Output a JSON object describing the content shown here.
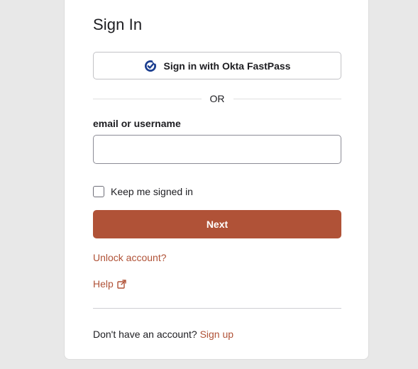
{
  "form": {
    "title": "Sign In",
    "fastpass_label": "Sign in with Okta FastPass",
    "separator": "OR",
    "username_label": "email or username",
    "username_value": "",
    "username_placeholder": "",
    "remember_label": "Keep me signed in",
    "remember_checked": false,
    "next_label": "Next"
  },
  "links": {
    "unlock": "Unlock account?",
    "help": "Help",
    "signup_prompt": "Don't have an account?",
    "signup_link": "Sign up"
  },
  "icons": {
    "fastpass": "okta-fastpass-check-icon",
    "help": "external-link-icon"
  },
  "colors": {
    "accent": "#b05237",
    "fastpass_icon": "#1a3d8f",
    "background": "#e8e8e8"
  }
}
